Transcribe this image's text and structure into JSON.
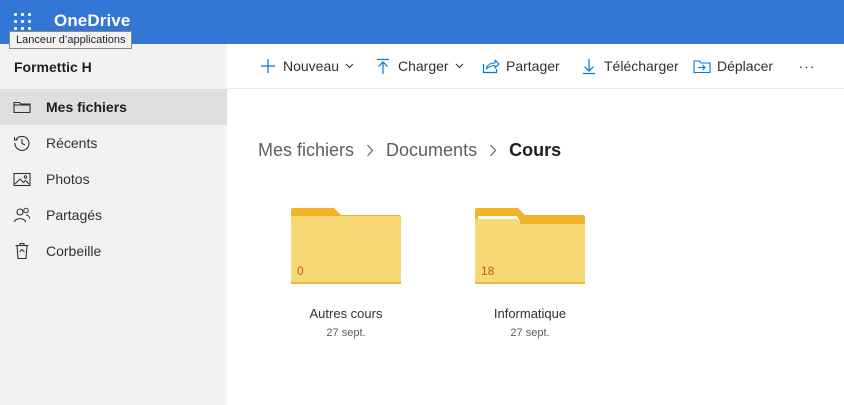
{
  "suite": {
    "brand": "OneDrive",
    "tooltip": "Lanceur d’applications"
  },
  "sidebar": {
    "user": "Formettic H",
    "items": [
      {
        "label": "Mes fichiers",
        "icon": "folder-icon",
        "active": true
      },
      {
        "label": "Récents",
        "icon": "clock-icon"
      },
      {
        "label": "Photos",
        "icon": "image-icon"
      },
      {
        "label": "Partagés",
        "icon": "people-icon"
      },
      {
        "label": "Corbeille",
        "icon": "trash-icon"
      }
    ]
  },
  "toolbar": {
    "new_label": "Nouveau",
    "upload_label": "Charger",
    "share_label": "Partager",
    "download_label": "Télécharger",
    "move_label": "Déplacer",
    "more_label": "···"
  },
  "breadcrumb": [
    "Mes fichiers",
    "Documents",
    "Cours"
  ],
  "folders": [
    {
      "name": "Autres cours",
      "date": "27 sept.",
      "count": "0",
      "shared": false
    },
    {
      "name": "Informatique",
      "date": "27 sept.",
      "count": "18",
      "shared": true
    }
  ],
  "colors": {
    "suitebar": "#3276d6",
    "folder_front": "#f8d775",
    "folder_back": "#f2b32a",
    "count_text": "#c75a0e"
  }
}
